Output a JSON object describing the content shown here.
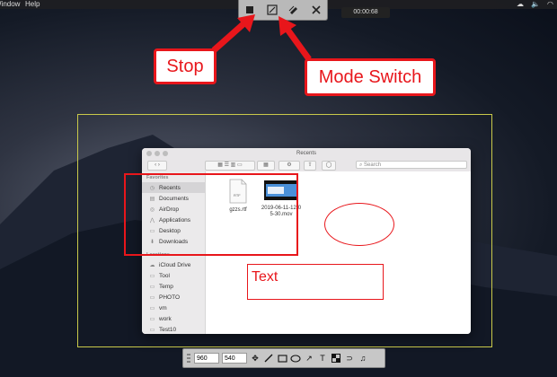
{
  "menubar": {
    "items": [
      "Window",
      "Help"
    ],
    "right_icons": [
      "cloud-icon",
      "speaker-icon",
      "wifi-icon"
    ]
  },
  "recorder": {
    "buttons": [
      "stop-icon",
      "mode-switch-icon",
      "pen-icon",
      "close-icon"
    ],
    "timer": "00:00:68"
  },
  "callouts": {
    "stop": "Stop",
    "mode_switch": "Mode Switch"
  },
  "finder": {
    "title": "Recents",
    "search_placeholder": "Search",
    "sidebar": {
      "favorites_header": "Favorites",
      "favorites": [
        "Recents",
        "Documents",
        "AirDrop",
        "Applications",
        "Desktop",
        "Downloads"
      ],
      "locations_header": "Locations",
      "locations": [
        "iCloud Drive",
        "Tool",
        "Temp",
        "PHOTO",
        "vm",
        "work",
        "Test10"
      ]
    },
    "files": [
      {
        "name": "gzzs.rtf",
        "type": "RTF"
      },
      {
        "name": "2019-06-11-12-05-30.mov",
        "line1": "2019-06-11-12-0",
        "line2": "5-30.mov"
      }
    ]
  },
  "annotation": {
    "text": "Text"
  },
  "draw_toolbar": {
    "width_value": "960",
    "height_value": "540",
    "tools": [
      "move-icon",
      "line-icon",
      "rectangle-icon",
      "ellipse-icon",
      "arrow-icon",
      "text-icon",
      "mosaic-icon",
      "undo-icon",
      "save-icon"
    ]
  },
  "colors": {
    "accent": "#e8161b",
    "capture_border": "#c9c94a"
  }
}
